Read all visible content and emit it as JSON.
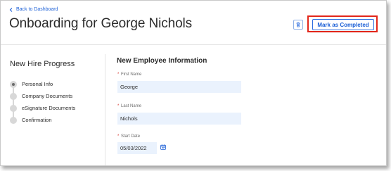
{
  "header": {
    "back_link": "Back to Dashboard",
    "title": "Onboarding for George Nichols",
    "complete_button": "Mark as Completed"
  },
  "sidebar": {
    "title": "New Hire Progress",
    "steps": [
      {
        "label": "Personal Info",
        "active": true
      },
      {
        "label": "Company Documents",
        "active": false
      },
      {
        "label": "eSignature Documents",
        "active": false
      },
      {
        "label": "Confirmation",
        "active": false
      }
    ]
  },
  "form": {
    "section_title": "New Employee Information",
    "required_mark": "*",
    "first_name": {
      "label": "First Name",
      "value": "George"
    },
    "last_name": {
      "label": "Last Name",
      "value": "Nichols"
    },
    "start_date": {
      "label": "Start Date",
      "value": "05/03/2022"
    }
  },
  "colors": {
    "accent": "#1b5fd6",
    "highlight": "#e3261a",
    "input_bg": "#eaf2fd"
  },
  "icons": [
    "chevron-left-icon",
    "trash-icon",
    "calendar-icon"
  ]
}
